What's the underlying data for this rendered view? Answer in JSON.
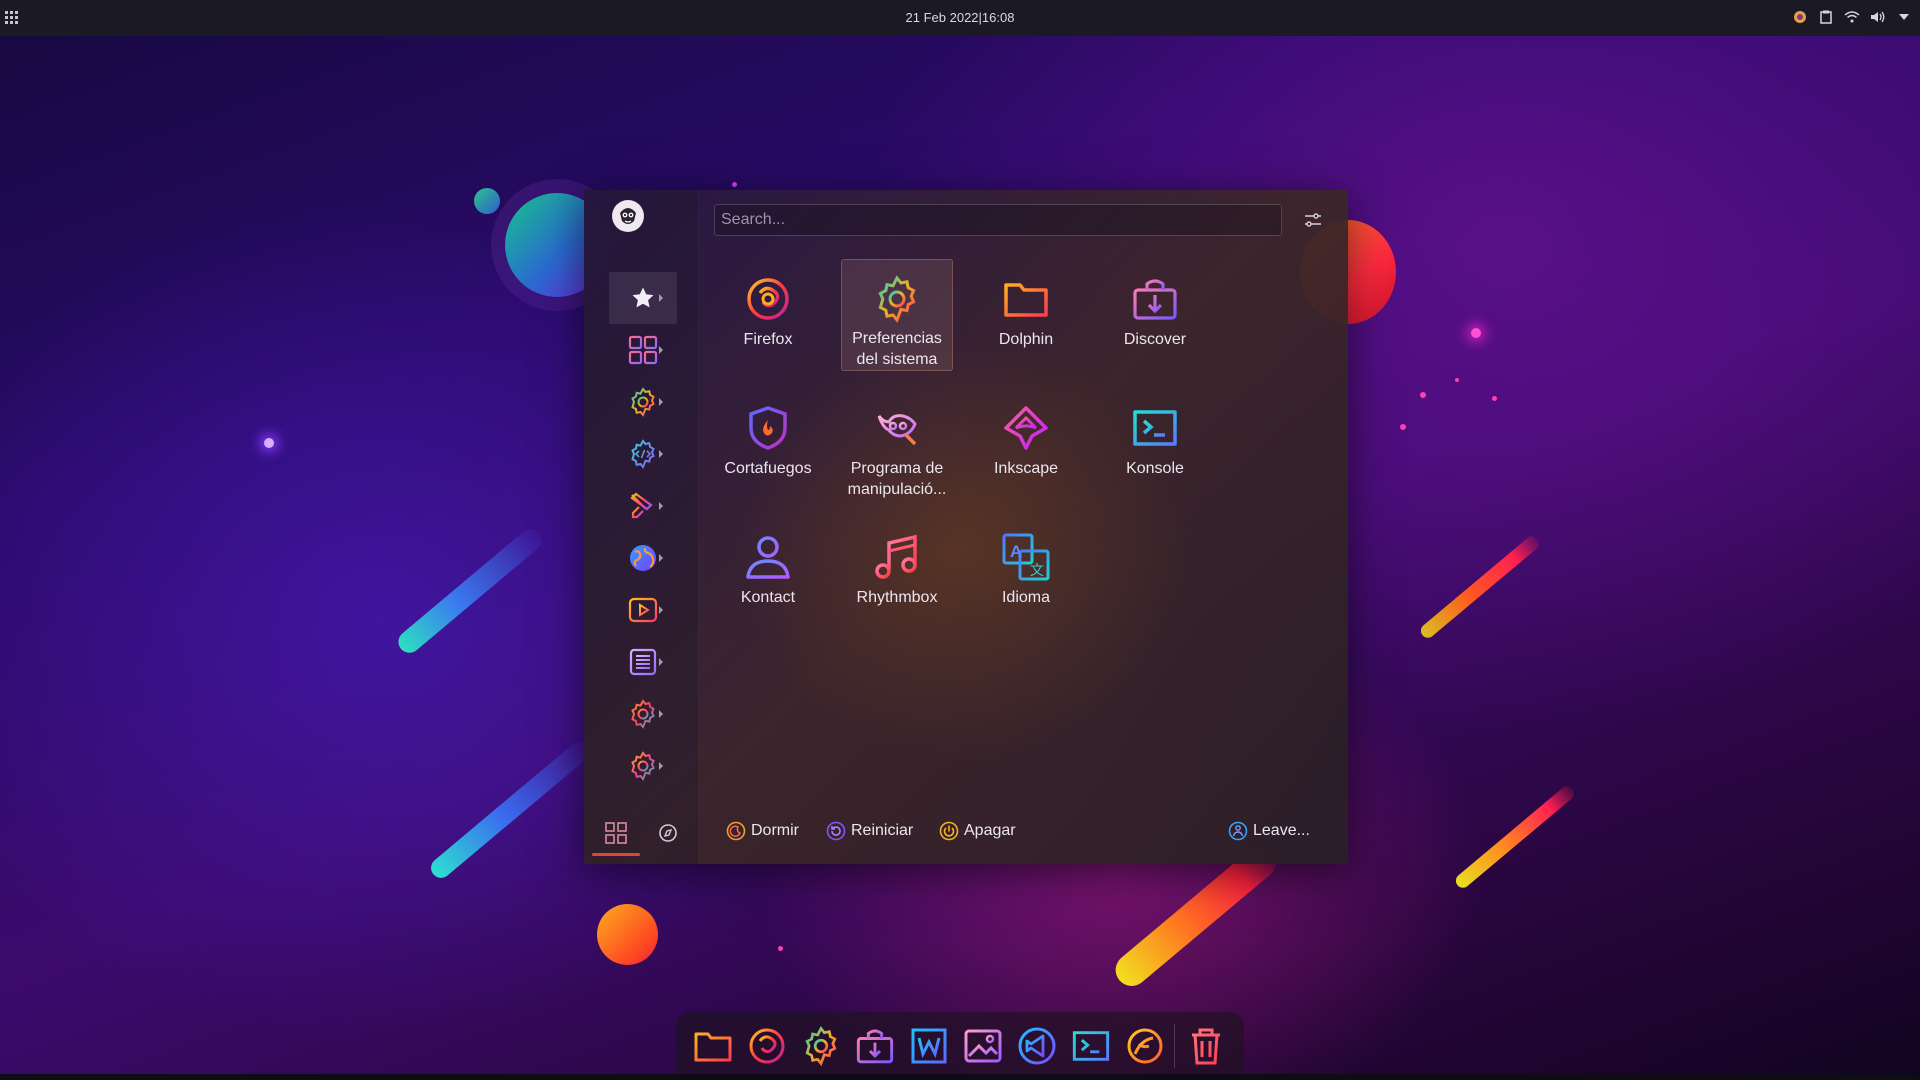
{
  "panel": {
    "clock": "21 Feb 2022|16:08",
    "launcher_icon": "app-grid-icon",
    "tray_icons": [
      "firefox-icon",
      "clipboard-icon",
      "wifi-icon",
      "volume-icon",
      "chevron-down-icon"
    ]
  },
  "menu": {
    "search_placeholder": "Search...",
    "categories": [
      {
        "name": "favorites",
        "icon": "star-icon"
      },
      {
        "name": "all-applications",
        "icon": "grid-icon"
      },
      {
        "name": "settings",
        "icon": "gear-icon"
      },
      {
        "name": "development",
        "icon": "code-gear-icon"
      },
      {
        "name": "graphics",
        "icon": "paint-roller-icon"
      },
      {
        "name": "internet",
        "icon": "globe-icon"
      },
      {
        "name": "multimedia",
        "icon": "play-icon"
      },
      {
        "name": "office",
        "icon": "document-icon"
      },
      {
        "name": "system",
        "icon": "gear-icon"
      },
      {
        "name": "utilities",
        "icon": "gear-icon"
      }
    ],
    "apps": [
      {
        "label": "Firefox",
        "icon": "firefox-icon"
      },
      {
        "label": "Preferencias del sistema",
        "icon": "settings-icon"
      },
      {
        "label": "Dolphin",
        "icon": "folder-icon"
      },
      {
        "label": "Discover",
        "icon": "discover-icon"
      },
      {
        "label": "Cortafuegos",
        "icon": "firewall-icon"
      },
      {
        "label": "Programa de manipulació...",
        "icon": "gimp-icon"
      },
      {
        "label": "Inkscape",
        "icon": "inkscape-icon"
      },
      {
        "label": "Konsole",
        "icon": "terminal-icon"
      },
      {
        "label": "Kontact",
        "icon": "contact-icon"
      },
      {
        "label": "Rhythmbox",
        "icon": "music-icon"
      },
      {
        "label": "Idioma",
        "icon": "language-icon"
      }
    ],
    "hovered_app": "Preferencias del sistema",
    "power": {
      "sleep": "Dormir",
      "restart": "Reiniciar",
      "shutdown": "Apagar",
      "leave": "Leave..."
    },
    "side_tabs": [
      "applications-tab",
      "places-tab"
    ]
  },
  "dock": {
    "items": [
      "folder-icon",
      "firefox-icon",
      "settings-icon",
      "discover-icon",
      "writer-icon",
      "image-viewer-icon",
      "vscode-icon",
      "terminal-icon",
      "app-icon",
      "trash-icon"
    ]
  },
  "colors": {
    "accent": "#e0453a",
    "panel": "#1b1924"
  }
}
